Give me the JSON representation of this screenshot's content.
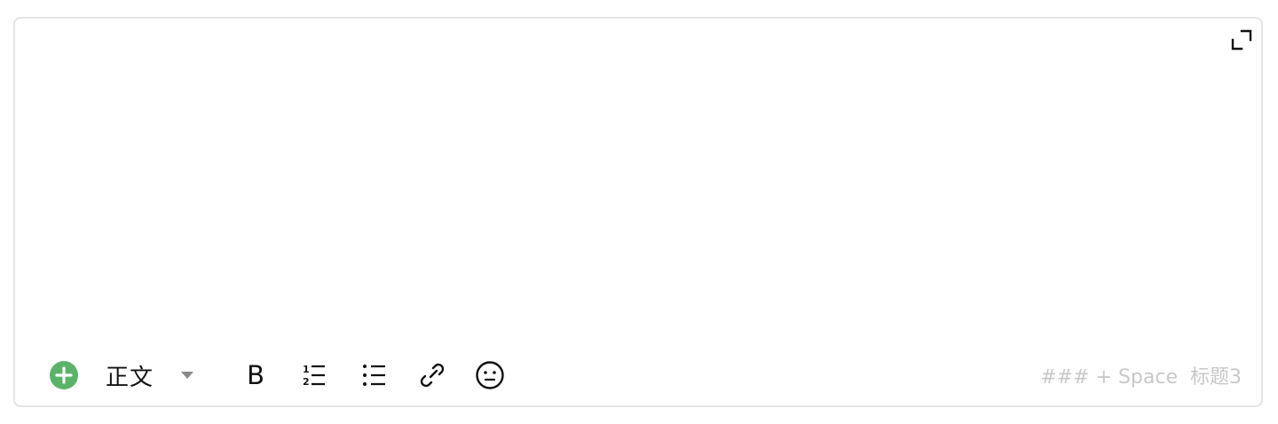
{
  "editor": {
    "content": "",
    "expand_icon": "expand-icon"
  },
  "toolbar": {
    "add_icon": "plus-circle-icon",
    "accent_color": "#5bb36a",
    "text_style_label": "正文",
    "text_style_caret_icon": "caret-down-icon",
    "bold_label": "B",
    "ordered_list_icon": "ordered-list-icon",
    "unordered_list_icon": "unordered-list-icon",
    "link_icon": "link-icon",
    "emoji_icon": "emoji-icon"
  },
  "shortcut_hint": "### + Space  标题3"
}
